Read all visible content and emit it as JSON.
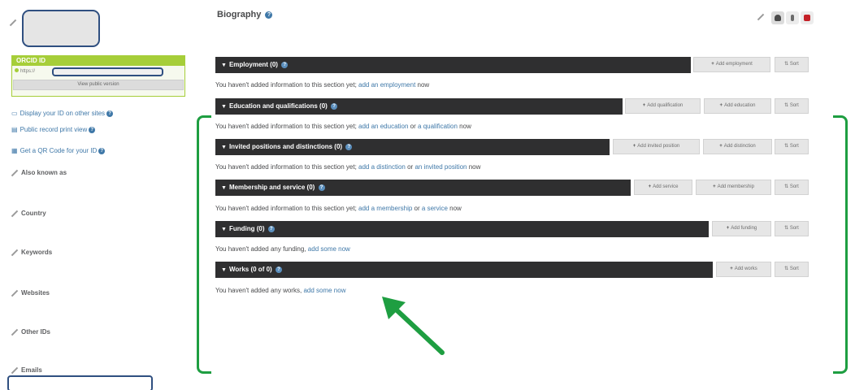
{
  "sidebar": {
    "orcid_header": "ORCID ID",
    "orcid_url_prefix": "https://",
    "view_public_version": "View public version",
    "links": [
      {
        "icon": "display-icon",
        "label": "Display your ID on other sites"
      },
      {
        "icon": "print-icon",
        "label": "Public record print view"
      },
      {
        "icon": "qr-code-icon",
        "label": "Get a QR Code for your ID"
      }
    ],
    "sections": [
      "Also known as",
      "Country",
      "Keywords",
      "Websites",
      "Other IDs",
      "Emails"
    ]
  },
  "biography": {
    "title": "Biography"
  },
  "sections": {
    "employment": {
      "title": "Employment (0)",
      "buttons": [
        "Add employment",
        "Sort"
      ],
      "message": "You haven't added information to this section yet;",
      "links": [
        "add an employment"
      ],
      "connectors": [],
      "suffix": "now"
    },
    "education": {
      "title": "Education and qualifications (0)",
      "buttons": [
        "Add qualification",
        "Add education",
        "Sort"
      ],
      "message": "You haven't added information to this section yet;",
      "links": [
        "add an education",
        "a qualification"
      ],
      "connectors": [
        "or"
      ],
      "suffix": "now"
    },
    "invited": {
      "title": "Invited positions and distinctions (0)",
      "buttons": [
        "Add invited position",
        "Add distinction",
        "Sort"
      ],
      "message": "You haven't added information to this section yet;",
      "links": [
        "add a distinction",
        "an invited position"
      ],
      "connectors": [
        "or"
      ],
      "suffix": "now"
    },
    "membership": {
      "title": "Membership and service (0)",
      "buttons": [
        "Add service",
        "Add membership",
        "Sort"
      ],
      "message": "You haven't added information to this section yet;",
      "links": [
        "add a membership",
        "a service"
      ],
      "connectors": [
        "or"
      ],
      "suffix": "now"
    },
    "funding": {
      "title": "Funding (0)",
      "buttons": [
        "Add funding",
        "Sort"
      ],
      "message": "You haven't added any funding,",
      "links": [
        "add some now"
      ],
      "connectors": [],
      "suffix": ""
    },
    "works": {
      "title": "Works (0 of 0)",
      "buttons": [
        "Add works",
        "Sort"
      ],
      "message": "You haven't added any works,",
      "links": [
        "add some now"
      ],
      "connectors": [],
      "suffix": ""
    }
  },
  "annotations": {
    "highlight_color": "#1e9e41"
  },
  "colors": {
    "orcid_green": "#a6ce39",
    "bar_dark": "#2f2f30",
    "link_blue": "#3f78a8",
    "private_red": "#c42027"
  }
}
